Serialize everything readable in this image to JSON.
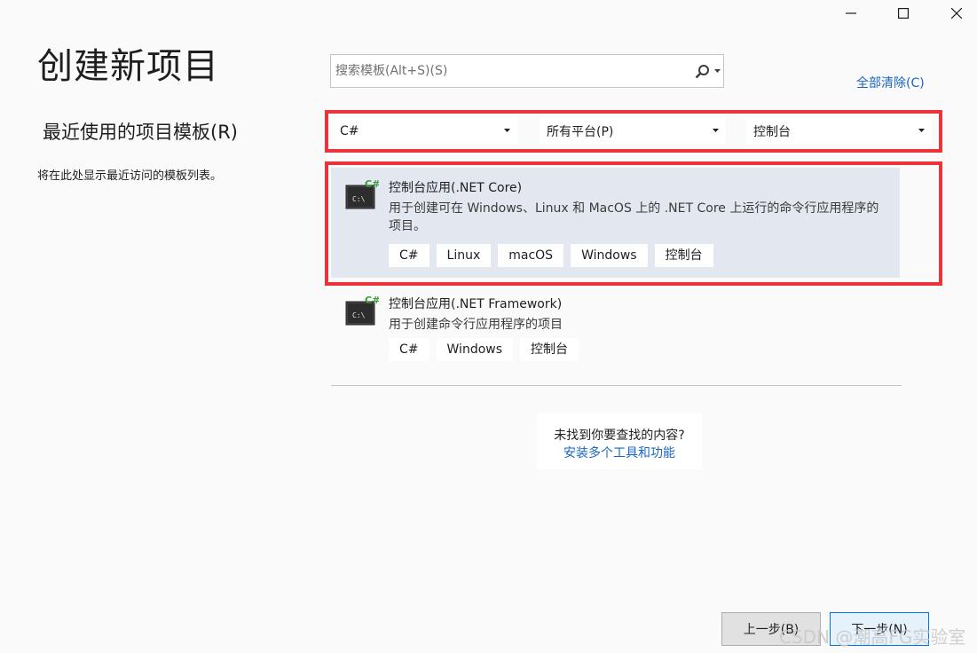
{
  "window": {
    "title": "创建新项目"
  },
  "recent": {
    "title": "最近使用的项目模板(R)",
    "empty_text": "将在此处显示最近访问的模板列表。"
  },
  "search": {
    "placeholder": "搜索模板(Alt+S)(S)",
    "value": ""
  },
  "clear_all_label": "全部清除(C)",
  "filters": {
    "language": "C#",
    "platform": "所有平台(P)",
    "project_type": "控制台"
  },
  "templates": [
    {
      "name": "控制台应用(.NET Core)",
      "description": "用于创建可在 Windows、Linux 和 MacOS 上的 .NET Core 上运行的命令行应用程序的项目。",
      "tags": [
        "C#",
        "Linux",
        "macOS",
        "Windows",
        "控制台"
      ],
      "selected": true,
      "icon": "console-app-icon"
    },
    {
      "name": "控制台应用(.NET Framework)",
      "description": "用于创建命令行应用程序的项目",
      "tags": [
        "C#",
        "Windows",
        "控制台"
      ],
      "selected": false,
      "icon": "console-app-icon"
    }
  ],
  "not_found": {
    "text": "未找到你要查找的内容?",
    "link": "安装多个工具和功能"
  },
  "buttons": {
    "prev": "上一步(B)",
    "next": "下一步(N)"
  },
  "watermark": "CSDN @潮高FG实验室",
  "colors": {
    "highlight": "#ee3338",
    "link": "#1a66c2",
    "selected_bg": "#e3e7ef",
    "csharp_green": "#3c9a3c"
  }
}
